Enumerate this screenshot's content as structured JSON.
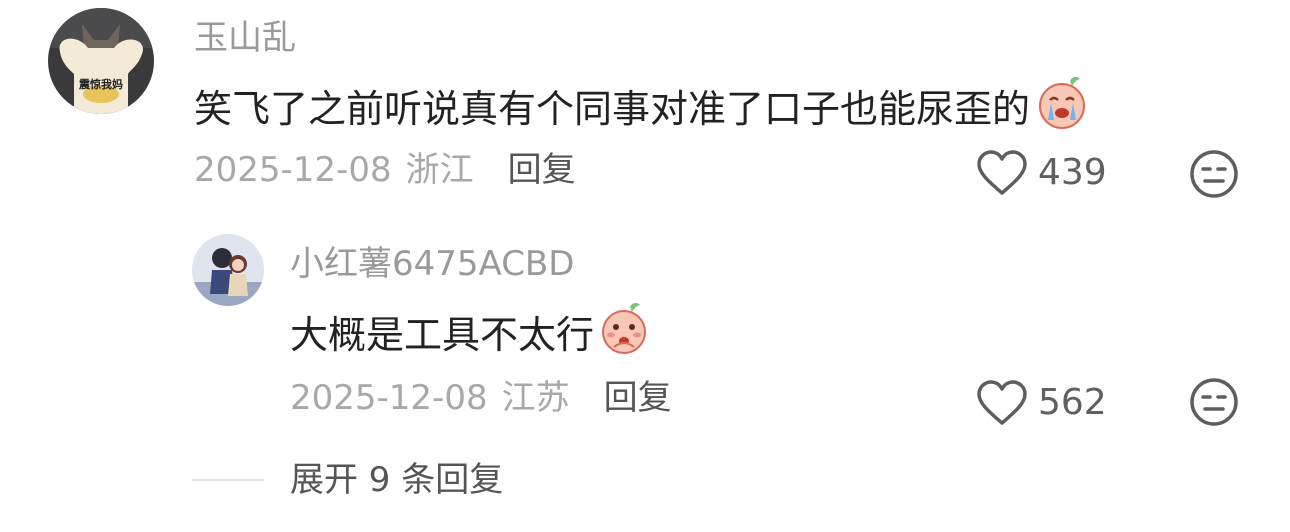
{
  "comment": {
    "avatar_text": "震惊我妈",
    "username": "玉山乱",
    "text": "笑飞了之前听说真有个同事对准了口子也能尿歪的",
    "emoji": "crying-peach-emoji",
    "date": "2025-12-08",
    "location": "浙江",
    "reply_label": "回复",
    "likes": "439"
  },
  "reply": {
    "username": "小红薯6475ACBD",
    "text": "大概是工具不太行",
    "emoji": "shy-peach-emoji",
    "date": "2025-12-08",
    "location": "江苏",
    "reply_label": "回复",
    "likes": "562"
  },
  "expand": {
    "label": "展开 9 条回复"
  },
  "icons": {
    "like": "heart-outline-icon",
    "dislike": "meh-face-icon"
  },
  "colors": {
    "username": "#9a9a9a",
    "text": "#222222",
    "meta": "#a8a8a8",
    "action": "#555555"
  }
}
